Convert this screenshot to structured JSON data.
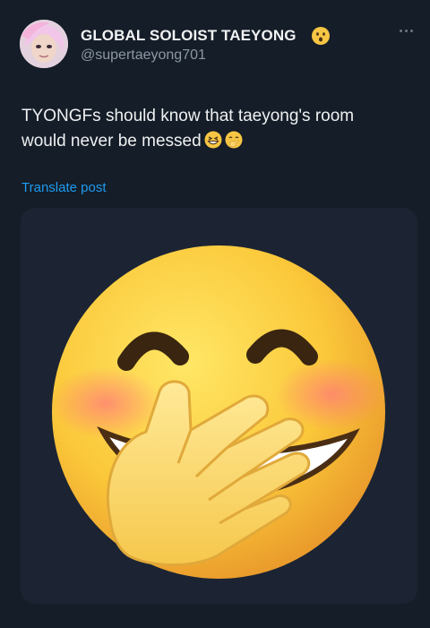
{
  "tweet": {
    "display_name": "GLOBAL SOLOIST TAEYONG",
    "handle": "@supertaeyong701",
    "text_line1": "TYONGFs should know that taeyong's room",
    "text_line2": "would never be messed",
    "translate_label": "Translate post"
  },
  "icons": {
    "name_emoji": "face-with-open-mouth-emoji",
    "text_emoji_1": "grinning-squinting-face-emoji",
    "text_emoji_2": "face-with-hand-over-mouth-emoji",
    "more": "more-dots-icon",
    "media": "face-with-hand-over-mouth-emoji"
  },
  "colors": {
    "background": "#151d28",
    "card": "#1c2433",
    "link": "#1d9bf0",
    "handle": "#8b98a5"
  }
}
